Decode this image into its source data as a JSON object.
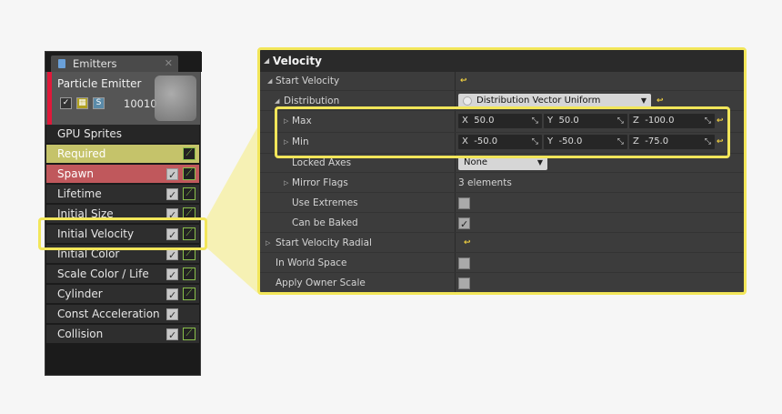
{
  "emitters": {
    "tab_label": "Emitters",
    "tab_close": "✕",
    "emitter_name": "Particle Emitter",
    "emitter_count": "10010",
    "modules": [
      {
        "label": "GPU Sprites"
      },
      {
        "label": "Required"
      },
      {
        "label": "Spawn"
      },
      {
        "label": "Lifetime"
      },
      {
        "label": "Initial Size"
      },
      {
        "label": "Initial Velocity"
      },
      {
        "label": "Initial Color"
      },
      {
        "label": "Scale Color / Life"
      },
      {
        "label": "Cylinder"
      },
      {
        "label": "Const Acceleration"
      },
      {
        "label": "Collision"
      }
    ]
  },
  "details": {
    "category": "Velocity",
    "rows": {
      "start_velocity": "Start Velocity",
      "distribution": "Distribution",
      "distribution_value": "Distribution Vector Uniform",
      "max": "Max",
      "min": "Min",
      "locked_axes": "Locked Axes",
      "locked_axes_value": "None",
      "mirror_flags": "Mirror Flags",
      "mirror_flags_value": "3 elements",
      "use_extremes": "Use Extremes",
      "can_be_baked": "Can be Baked",
      "start_velocity_radial": "Start Velocity Radial",
      "in_world_space": "In World Space",
      "apply_owner_scale": "Apply Owner Scale"
    },
    "max": {
      "x": "50.0",
      "y": "50.0",
      "z": "-100.0"
    },
    "min": {
      "x": "-50.0",
      "y": "-50.0",
      "z": "-75.0"
    },
    "axis_labels": {
      "x": "X",
      "y": "Y",
      "z": "Z"
    },
    "reset_glyph": "↩"
  },
  "colors": {
    "highlight": "#f2e65a",
    "required": "#c5c36a",
    "spawn": "#c0585c",
    "emitter_accent": "#e0193a"
  }
}
